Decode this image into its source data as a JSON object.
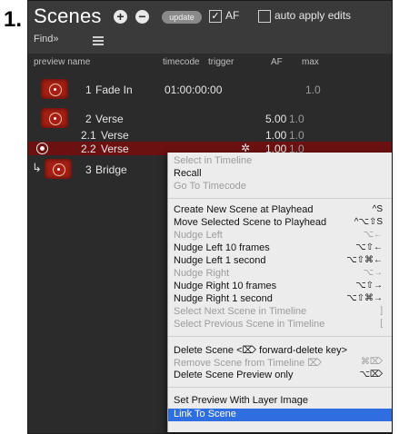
{
  "step": "1.",
  "header": {
    "title": "Scenes",
    "add_icon_glyph": "+",
    "remove_icon_glyph": "−",
    "update_label": "update",
    "af_label": "AF",
    "af_checked": "✓",
    "auto_apply_label": "auto apply edits",
    "find_label": "Find»"
  },
  "columns": {
    "preview_name": "preview name",
    "timecode": "timecode",
    "trigger": "trigger",
    "af": "AF",
    "max": "max"
  },
  "rows": [
    {
      "num": "1",
      "name": "Fade In",
      "timecode": "01:00:00:00",
      "af": "",
      "max": "1.0"
    },
    {
      "num": "2",
      "name": "Verse",
      "timecode": "",
      "af": "5.00",
      "max": "1.0"
    },
    {
      "num": "2.1",
      "name": "Verse",
      "timecode": "",
      "af": "1.00",
      "max": "1.0"
    },
    {
      "num": "2.2",
      "name": "Verse",
      "timecode": "",
      "af": "1.00",
      "max": "1.0"
    },
    {
      "num": "3",
      "name": "Bridge",
      "timecode": "",
      "af": "",
      "max": ""
    }
  ],
  "context_menu": {
    "select_in_timeline": "Select in Timeline",
    "recall": "Recall",
    "go_to_timecode": "Go To Timecode",
    "create_new_scene": "Create New Scene at Playhead",
    "create_new_scene_sc": "^S",
    "move_selected": "Move Selected Scene to Playhead",
    "move_selected_sc": "^⌥⇧S",
    "nudge_left": "Nudge Left",
    "nudge_left_sc": "⌥←",
    "nudge_left_10": "Nudge Left 10 frames",
    "nudge_left_10_sc": "⌥⇧←",
    "nudge_left_1s": "Nudge Left 1 second",
    "nudge_left_1s_sc": "⌥⇧⌘←",
    "nudge_right": "Nudge Right",
    "nudge_right_sc": "⌥→",
    "nudge_right_10": "Nudge Right 10 frames",
    "nudge_right_10_sc": "⌥⇧→",
    "nudge_right_1s": "Nudge Right 1 second",
    "nudge_right_1s_sc": "⌥⇧⌘→",
    "select_next": "Select Next Scene in Timeline",
    "select_next_sc": "]",
    "select_prev": "Select Previous Scene in Timeline",
    "select_prev_sc": "[",
    "delete_scene": "Delete Scene <⌦ forward-delete key>",
    "remove_scene": "Remove Scene from Timeline ⌦",
    "remove_scene_sc": "⌘⌦",
    "delete_preview": "Delete Scene Preview only",
    "delete_preview_sc": "⌥⌦",
    "set_preview": "Set Preview With Layer Image",
    "link_to_scene": "Link To Scene"
  }
}
